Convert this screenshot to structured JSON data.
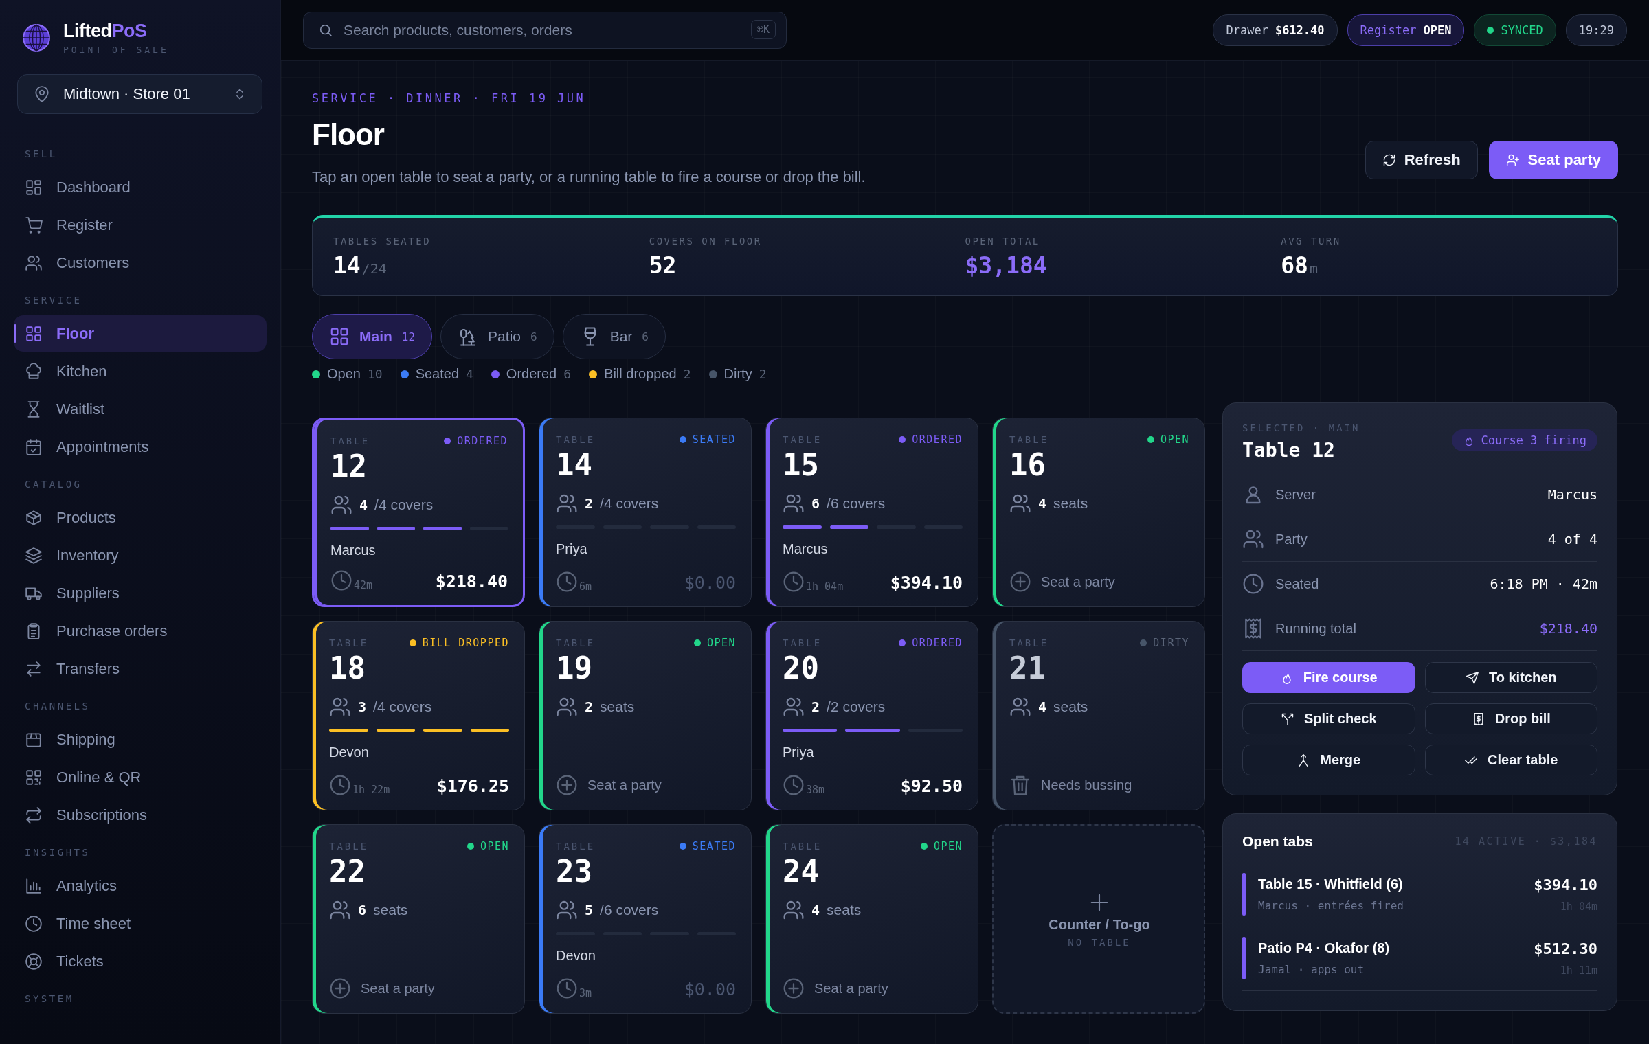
{
  "brand": {
    "name": "Lifted",
    "name_accent": "PoS",
    "tagline": "POINT OF SALE"
  },
  "store_selector": {
    "value": "Midtown · Store 01"
  },
  "nav": [
    {
      "heading": "SELL",
      "items": [
        {
          "label": "Dashboard",
          "selected": false
        },
        {
          "label": "Register",
          "selected": false
        },
        {
          "label": "Customers",
          "selected": false
        }
      ]
    },
    {
      "heading": "SERVICE",
      "items": [
        {
          "label": "Floor",
          "selected": true
        },
        {
          "label": "Kitchen",
          "selected": false
        },
        {
          "label": "Waitlist",
          "selected": false
        },
        {
          "label": "Appointments",
          "selected": false
        }
      ]
    },
    {
      "heading": "CATALOG",
      "items": [
        {
          "label": "Products",
          "selected": false
        },
        {
          "label": "Inventory",
          "selected": false
        },
        {
          "label": "Suppliers",
          "selected": false
        },
        {
          "label": "Purchase orders",
          "selected": false
        },
        {
          "label": "Transfers",
          "selected": false
        }
      ]
    },
    {
      "heading": "CHANNELS",
      "items": [
        {
          "label": "Shipping",
          "selected": false
        },
        {
          "label": "Online & QR",
          "selected": false
        },
        {
          "label": "Subscriptions",
          "selected": false
        }
      ]
    },
    {
      "heading": "INSIGHTS",
      "items": [
        {
          "label": "Analytics",
          "selected": false
        },
        {
          "label": "Time sheet",
          "selected": false
        },
        {
          "label": "Tickets",
          "selected": false
        }
      ]
    },
    {
      "heading": "SYSTEM"
    }
  ],
  "search": {
    "placeholder": "Search products, customers, orders",
    "shortcut": "⌘K"
  },
  "status_pills": [
    {
      "kind": "drawer",
      "label": "Drawer",
      "value": "$612.40"
    },
    {
      "kind": "register",
      "label": "Register",
      "value": "OPEN"
    },
    {
      "kind": "sync",
      "label": "SYNCED"
    },
    {
      "kind": "clock",
      "label": "19:29"
    }
  ],
  "header": {
    "breadcrumb": "SERVICE · DINNER · FRI 19 JUN",
    "title": "Floor",
    "subtitle": "Tap an open table to seat a party, or a running table to fire a course or drop the bill.",
    "buttons": [
      {
        "kind": "secondary",
        "label": "Refresh"
      },
      {
        "kind": "primary",
        "label": "Seat party"
      }
    ]
  },
  "stats": [
    {
      "label": "TABLES SEATED",
      "value": "14",
      "suffix": "/24",
      "highlight": false
    },
    {
      "label": "COVERS ON FLOOR",
      "value": "52",
      "highlight": false
    },
    {
      "label": "OPEN TOTAL",
      "value": "$3,184",
      "highlight": true
    },
    {
      "label": "AVG TURN",
      "value": "68",
      "suffix": "m",
      "highlight": false
    }
  ],
  "zones": [
    {
      "label": "Main",
      "count": "12",
      "selected": true
    },
    {
      "label": "Patio",
      "count": "6",
      "selected": false
    },
    {
      "label": "Bar",
      "count": "6",
      "selected": false
    }
  ],
  "legend": [
    {
      "label": "Open",
      "count": "10",
      "color": "#22d68a"
    },
    {
      "label": "Seated",
      "count": "4",
      "color": "#3b7bf6"
    },
    {
      "label": "Ordered",
      "count": "6",
      "color": "#7c5cf6"
    },
    {
      "label": "Bill dropped",
      "count": "2",
      "color": "#fbbf24"
    },
    {
      "label": "Dirty",
      "count": "2",
      "color": "#475569"
    }
  ],
  "tables": [
    {
      "kind": "running",
      "caption": "TABLE",
      "number": "12",
      "status": "ORDERED",
      "color": "#7c5cf6",
      "selected": true,
      "party": "4",
      "capacity": "/4 covers",
      "courses": [
        {
          "done": true
        },
        {
          "done": true
        },
        {
          "done": true
        },
        {
          "done": false
        }
      ],
      "server": "Marcus",
      "elapsed": "42m",
      "total": "$218.40",
      "total_pending": false
    },
    {
      "kind": "running",
      "caption": "TABLE",
      "number": "14",
      "status": "SEATED",
      "color": "#3b7bf6",
      "selected": false,
      "party": "2",
      "capacity": "/4 covers",
      "courses": [
        {
          "done": false
        },
        {
          "done": false
        },
        {
          "done": false
        },
        {
          "done": false
        }
      ],
      "server": "Priya",
      "elapsed": "6m",
      "total": "$0.00",
      "total_pending": true
    },
    {
      "kind": "running",
      "caption": "TABLE",
      "number": "15",
      "status": "ORDERED",
      "color": "#7c5cf6",
      "selected": false,
      "party": "6",
      "capacity": "/6 covers",
      "courses": [
        {
          "done": true
        },
        {
          "done": true
        },
        {
          "done": false
        },
        {
          "done": false
        }
      ],
      "server": "Marcus",
      "elapsed": "1h 04m",
      "total": "$394.10",
      "total_pending": false
    },
    {
      "kind": "open",
      "caption": "TABLE",
      "number": "16",
      "status": "OPEN",
      "color": "#22d68a",
      "selected": false,
      "party": "4",
      "capacity": "seats",
      "action": "Seat a party"
    },
    {
      "kind": "running",
      "caption": "TABLE",
      "number": "18",
      "status": "BILL DROPPED",
      "color": "#fbbf24",
      "selected": false,
      "party": "3",
      "capacity": "/4 covers",
      "courses": [
        {
          "done": true
        },
        {
          "done": true
        },
        {
          "done": true
        },
        {
          "done": true
        }
      ],
      "server": "Devon",
      "elapsed": "1h 22m",
      "total": "$176.25",
      "total_pending": false
    },
    {
      "kind": "open",
      "caption": "TABLE",
      "number": "19",
      "status": "OPEN",
      "color": "#22d68a",
      "selected": false,
      "party": "2",
      "capacity": "seats",
      "action": "Seat a party"
    },
    {
      "kind": "running",
      "caption": "TABLE",
      "number": "20",
      "status": "ORDERED",
      "color": "#7c5cf6",
      "selected": false,
      "party": "2",
      "capacity": "/2 covers",
      "courses": [
        {
          "done": true
        },
        {
          "done": true
        },
        {
          "done": false
        }
      ],
      "server": "Priya",
      "elapsed": "38m",
      "total": "$92.50",
      "total_pending": false
    },
    {
      "kind": "dirty",
      "caption": "TABLE",
      "number": "21",
      "status": "DIRTY",
      "color": "#475569",
      "selected": false,
      "party": "4",
      "capacity": "seats",
      "action": "Needs bussing"
    },
    {
      "kind": "open",
      "caption": "TABLE",
      "number": "22",
      "status": "OPEN",
      "color": "#22d68a",
      "selected": false,
      "party": "6",
      "capacity": "seats",
      "action": "Seat a party"
    },
    {
      "kind": "running",
      "caption": "TABLE",
      "number": "23",
      "status": "SEATED",
      "color": "#3b7bf6",
      "selected": false,
      "party": "5",
      "capacity": "/6 covers",
      "courses": [
        {
          "done": false
        },
        {
          "done": false
        },
        {
          "done": false
        },
        {
          "done": false
        }
      ],
      "server": "Devon",
      "elapsed": "3m",
      "total": "$0.00",
      "total_pending": true
    },
    {
      "kind": "open",
      "caption": "TABLE",
      "number": "24",
      "status": "OPEN",
      "color": "#22d68a",
      "selected": false,
      "party": "4",
      "capacity": "seats",
      "action": "Seat a party"
    },
    {
      "kind": "counter",
      "label": "Counter / To-go",
      "sublabel": "NO TABLE"
    }
  ],
  "selected_table": {
    "caption": "SELECTED · MAIN",
    "title": "Table 12",
    "badge": "Course 3 firing",
    "rows": [
      {
        "label": "Server",
        "value": "Marcus",
        "highlight": false
      },
      {
        "label": "Party",
        "value": "4 of 4",
        "highlight": false
      },
      {
        "label": "Seated",
        "value": "6:18 PM · 42m",
        "highlight": false
      },
      {
        "label": "Running total",
        "value": "$218.40",
        "highlight": true
      }
    ],
    "actions": [
      {
        "kind": "primary",
        "label": "Fire course"
      },
      {
        "kind": "secondary",
        "label": "To kitchen"
      },
      {
        "kind": "secondary",
        "label": "Split check"
      },
      {
        "kind": "secondary",
        "label": "Drop bill"
      },
      {
        "kind": "secondary",
        "label": "Merge"
      },
      {
        "kind": "secondary",
        "label": "Clear table"
      }
    ]
  },
  "open_tabs": {
    "title": "Open tabs",
    "summary": "14 ACTIVE · $3,184",
    "items": [
      {
        "name": "Table 15 · Whitfield (6)",
        "detail": "Marcus · entrées fired",
        "total": "$394.10",
        "elapsed": "1h 04m"
      },
      {
        "name": "Patio P4 · Okafor (8)",
        "detail": "Jamal · apps out",
        "total": "$512.30",
        "elapsed": "1h 11m"
      }
    ]
  }
}
